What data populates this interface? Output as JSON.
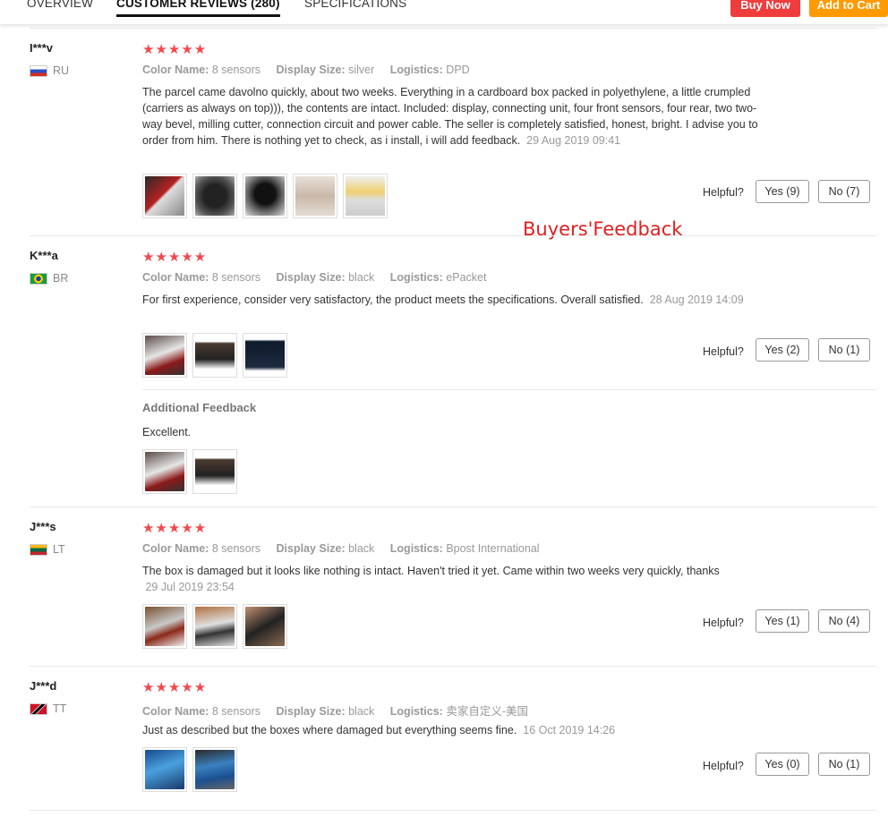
{
  "tabs": [
    {
      "label": "OVERVIEW"
    },
    {
      "label": "CUSTOMER REVIEWS (280)"
    },
    {
      "label": "SPECIFICATIONS"
    }
  ],
  "actions": {
    "buy_now": "Buy Now",
    "add_to_cart": "Add to Cart"
  },
  "labels": {
    "color_name": "Color Name:",
    "display_size": "Display Size:",
    "logistics": "Logistics:",
    "helpful": "Helpful?",
    "additional_feedback": "Additional Feedback"
  },
  "watermark": "Buyers'Feedback",
  "stars": "★★★★★",
  "reviews": [
    {
      "user": "I***v",
      "country": "RU",
      "color": "8 sensors",
      "display": "silver",
      "logistics": "DPD",
      "text": "The parcel came davolno quickly, about two weeks. Everything in a cardboard box packed in polyethylene, a little crumpled (carriers as always on top))), the contents are intact. Included: display, connecting unit, four front sensors, four rear, two two-way bevel, milling cutter, connection circuit and power cable. The seller is completely satisfied, honest, bright. I advise you to order from him. There is nothing yet to check, as i install, i will add feedback.",
      "date": "29 Aug 2019 09:41",
      "yes": "Yes (9)",
      "no": "No (7)"
    },
    {
      "user": "K***a",
      "country": "BR",
      "color": "8 sensors",
      "display": "black",
      "logistics": "ePacket",
      "text": "For first experience, consider very satisfactory, the product meets the specifications. Overall satisfied.",
      "date": "28 Aug 2019 14:09",
      "yes": "Yes (2)",
      "no": "No (1)",
      "additional": "Excellent."
    },
    {
      "user": "J***s",
      "country": "LT",
      "color": "8 sensors",
      "display": "black",
      "logistics": "Bpost International",
      "text": "The box is damaged but it looks like nothing is intact. Haven't tried it yet. Came within two weeks very quickly, thanks",
      "date": "29 Jul 2019 23:54",
      "yes": "Yes (1)",
      "no": "No (4)"
    },
    {
      "user": "J***d",
      "country": "TT",
      "color": "8 sensors",
      "display": "black",
      "logistics": "卖家自定义-美国",
      "text": "Just as described but the boxes where damaged but everything seems fine.",
      "date": "16 Oct 2019 14:26",
      "yes": "Yes (0)",
      "no": "No (1)"
    }
  ],
  "colors": {
    "accent_red": "#ef3d3d",
    "accent_orange": "#ff9a00",
    "star": "#f2484e"
  }
}
